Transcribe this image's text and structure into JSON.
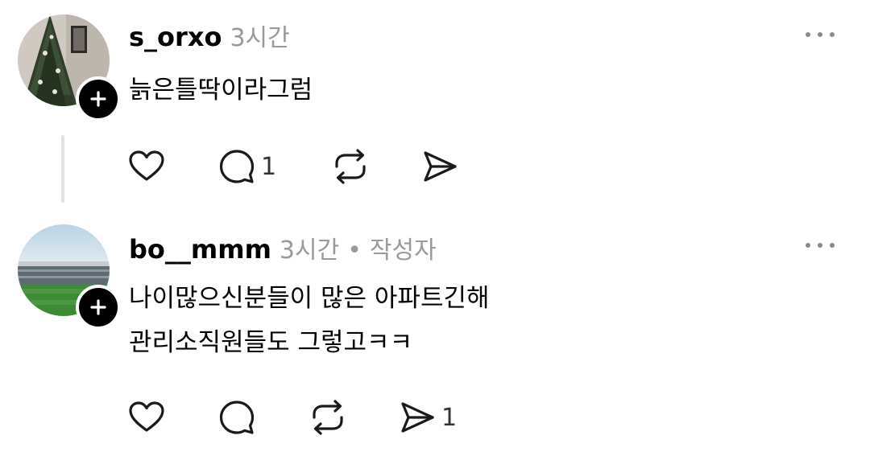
{
  "posts": [
    {
      "username": "s_orxo",
      "time": "3시간",
      "author_tag": "",
      "lines": [
        "늙은틀딱이라그럼"
      ],
      "avatar_icon": "christmas-tree-photo",
      "counts": {
        "like": "",
        "reply": "1",
        "repost": "",
        "share": ""
      }
    },
    {
      "username": "bo__mmm",
      "time": "3시간",
      "separator": "•",
      "author_tag": "작성자",
      "lines": [
        "나이많으신분들이 많은 아파트긴해",
        "관리소직원들도 그렇고ㅋㅋ"
      ],
      "avatar_icon": "stadium-photo",
      "counts": {
        "like": "",
        "reply": "",
        "repost": "",
        "share": "1"
      }
    }
  ],
  "icons": {
    "follow": "plus-icon",
    "more": "more-horizontal-icon",
    "like": "heart-icon",
    "reply": "comment-icon",
    "repost": "repost-icon",
    "share": "send-icon"
  },
  "colors": {
    "text": "#000000",
    "meta": "#9a9a9a",
    "icon": "#1a1a1a",
    "thread_line": "#e2e2e2"
  }
}
